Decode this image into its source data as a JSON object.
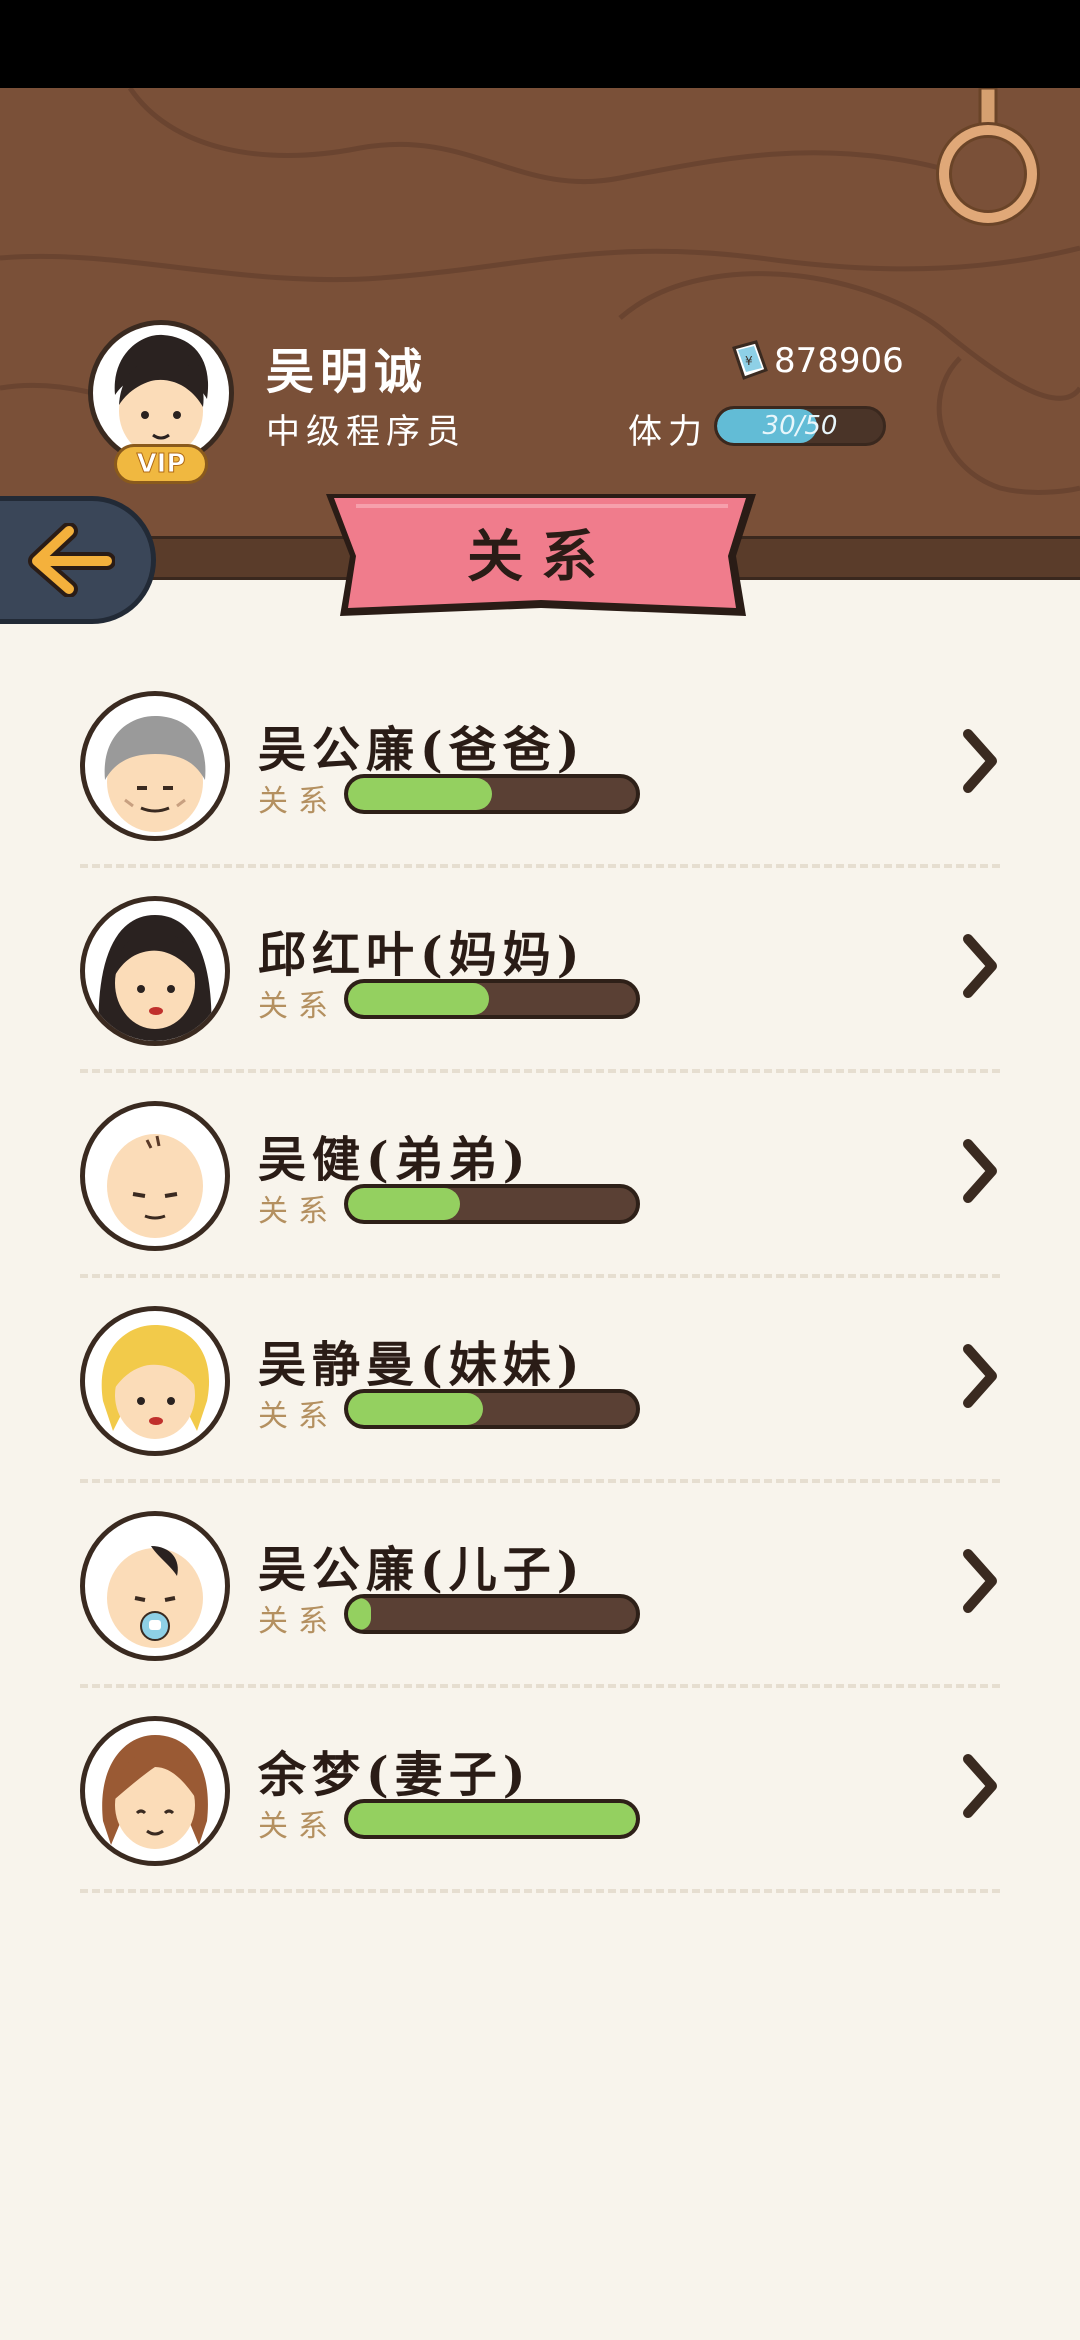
{
  "player": {
    "name": "吴明诚",
    "title": "中级程序员",
    "vip_label": "VIP",
    "money": "878906",
    "stamina_label": "体力",
    "stamina_text": "30/50",
    "stamina_fraction": 0.6
  },
  "page_title": "关系",
  "colors": {
    "header_wood": "#7a5038",
    "ribbon": "#f07c8c",
    "bar_fill": "#94d060",
    "stamina_fill": "#62bcd6"
  },
  "relations": [
    {
      "name": "吴公廉(爸爸)",
      "label": "关系",
      "level": 0.5,
      "avatar": "grandpa-avatar-icon"
    },
    {
      "name": "邱红叶(妈妈)",
      "label": "关系",
      "level": 0.49,
      "avatar": "mother-avatar-icon"
    },
    {
      "name": "吴健(弟弟)",
      "label": "关系",
      "level": 0.39,
      "avatar": "brother-avatar-icon"
    },
    {
      "name": "吴静曼(妹妹)",
      "label": "关系",
      "level": 0.47,
      "avatar": "sister-avatar-icon"
    },
    {
      "name": "吴公廉(儿子)",
      "label": "关系",
      "level": 0.08,
      "avatar": "baby-avatar-icon"
    },
    {
      "name": "余梦(妻子)",
      "label": "关系",
      "level": 1.0,
      "avatar": "wife-avatar-icon"
    }
  ]
}
